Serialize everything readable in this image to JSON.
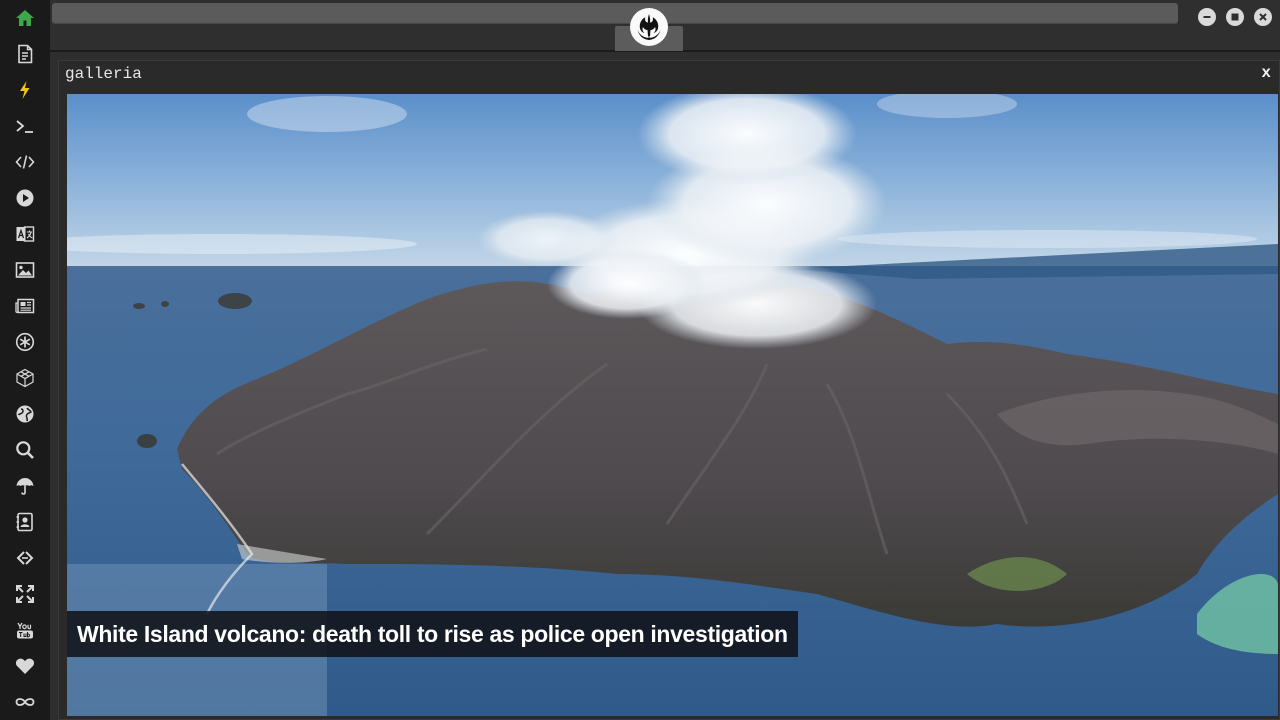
{
  "sidebar": {
    "items": [
      {
        "name": "home-icon",
        "icon": "home",
        "color": "#3ca84b"
      },
      {
        "name": "document-icon",
        "icon": "document",
        "color": "#d8d8d8"
      },
      {
        "name": "lightning-icon",
        "icon": "bolt",
        "color": "#f0c419"
      },
      {
        "name": "terminal-icon",
        "icon": "terminal",
        "color": "#d8d8d8"
      },
      {
        "name": "code-icon",
        "icon": "code",
        "color": "#d8d8d8"
      },
      {
        "name": "play-icon",
        "icon": "play",
        "color": "#d8d8d8"
      },
      {
        "name": "translate-icon",
        "icon": "translate",
        "color": "#d8d8d8"
      },
      {
        "name": "image-icon",
        "icon": "image",
        "color": "#d8d8d8"
      },
      {
        "name": "newspaper-icon",
        "icon": "newspaper",
        "color": "#d8d8d8"
      },
      {
        "name": "settings-icon",
        "icon": "asterisk",
        "color": "#d8d8d8"
      },
      {
        "name": "cube-icon",
        "icon": "cube",
        "color": "#d8d8d8"
      },
      {
        "name": "globe-icon",
        "icon": "globe",
        "color": "#d8d8d8"
      },
      {
        "name": "search-icon",
        "icon": "search",
        "color": "#d8d8d8"
      },
      {
        "name": "umbrella-icon",
        "icon": "umbrella",
        "color": "#d8d8d8"
      },
      {
        "name": "contacts-icon",
        "icon": "contacts",
        "color": "#d8d8d8"
      },
      {
        "name": "embed-icon",
        "icon": "embed",
        "color": "#d8d8d8"
      },
      {
        "name": "fullscreen-icon",
        "icon": "expand",
        "color": "#d8d8d8"
      },
      {
        "name": "youtube-icon",
        "icon": "youtube",
        "color": "#d8d8d8"
      },
      {
        "name": "heart-icon",
        "icon": "heart",
        "color": "#d8d8d8"
      },
      {
        "name": "infinity-icon",
        "icon": "infinity",
        "color": "#d8d8d8"
      }
    ]
  },
  "topbar": {
    "logo_icon": "rebel-alliance-icon",
    "window_controls": [
      "minimize-icon",
      "maximize-icon",
      "close-icon"
    ]
  },
  "panel": {
    "title": "galleria",
    "close_label": "x"
  },
  "gallery": {
    "image_subject": "aerial photo of a volcanic island with a steam plume",
    "caption": "White Island volcano: death toll to rise as police open investigation"
  }
}
